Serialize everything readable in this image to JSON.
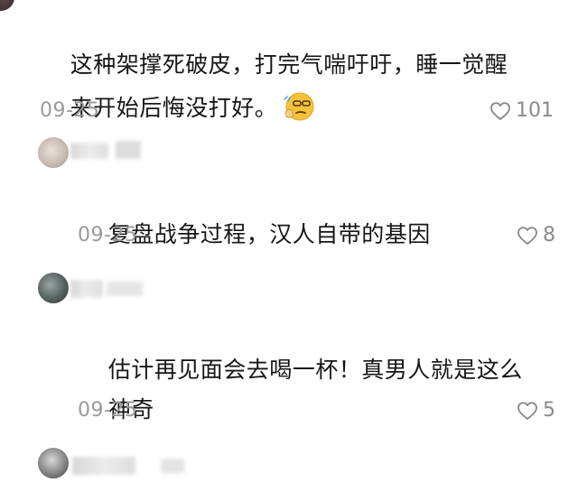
{
  "comments": [
    {
      "line1": "这种架撑死破皮，打完气喘吁吁，睡一觉醒",
      "line2": "来开始后悔没打好。",
      "date": "09-25",
      "likes": "101",
      "emoji_icon": "thinking-face-emoji"
    },
    {
      "text": "复盘战争过程，汉人自带的基因",
      "date": "09-25",
      "likes": "8"
    },
    {
      "line1": "估计再见面会去喝一杯！真男人就是这么",
      "line2": "神奇",
      "date": "09-25",
      "likes": "5"
    }
  ],
  "icons": {
    "like": "heart-outline-icon"
  },
  "colors": {
    "text": "#161616",
    "meta": "#9a9a9a",
    "like": "#8a8a8a",
    "background": "#ffffff"
  }
}
